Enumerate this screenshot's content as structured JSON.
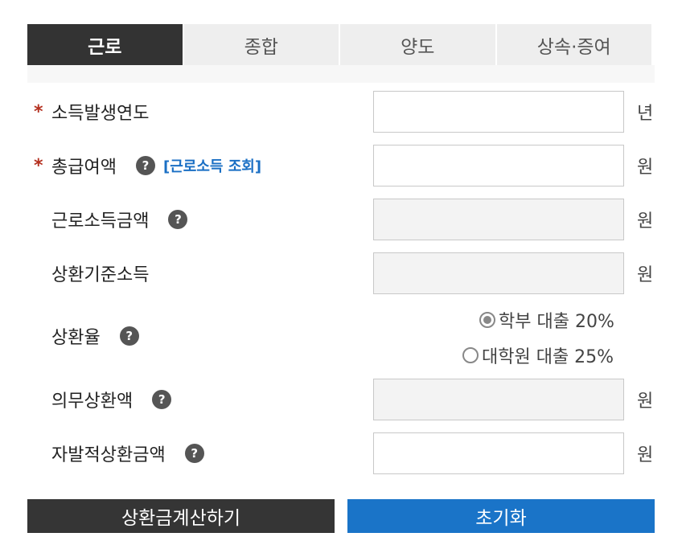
{
  "tabs": [
    "근로",
    "종합",
    "양도",
    "상속·증여"
  ],
  "form": {
    "income_year": {
      "label": "소득발생연도",
      "required": true,
      "unit": "년",
      "value": ""
    },
    "total_pay": {
      "label": "총급여액",
      "required": true,
      "link": "[근로소득 조회]",
      "unit": "원",
      "value": ""
    },
    "earned_income": {
      "label": "근로소득금액",
      "unit": "원",
      "value": ""
    },
    "base_income": {
      "label": "상환기준소득",
      "unit": "원",
      "value": ""
    },
    "rate": {
      "label": "상환율",
      "options": [
        {
          "label": "학부 대출 20%",
          "selected": true
        },
        {
          "label": "대학원 대출 25%",
          "selected": false
        }
      ]
    },
    "mandatory_amount": {
      "label": "의무상환액",
      "unit": "원",
      "value": ""
    },
    "voluntary_amount": {
      "label": "자발적상환금액",
      "unit": "원",
      "value": ""
    }
  },
  "help_glyph": "?",
  "required_mark": "*",
  "buttons": {
    "calculate": "상환금계산하기",
    "reset": "초기화"
  }
}
